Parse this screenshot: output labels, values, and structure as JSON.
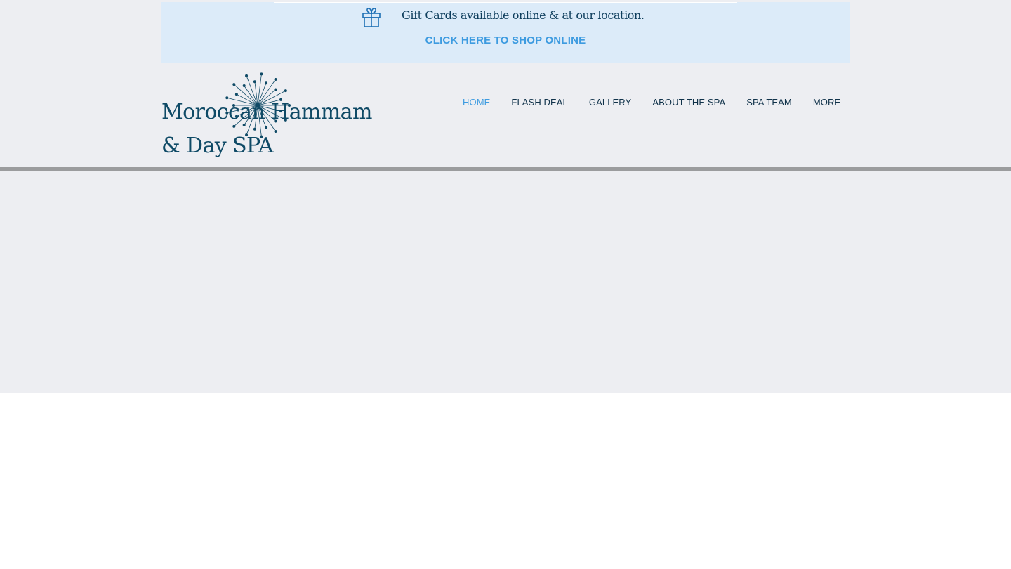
{
  "banner": {
    "gift_icon": "gift-icon",
    "gift_text": "Gift Cards available online & at our location.",
    "shop_link": "CLICK HERE TO SHOP ONLINE"
  },
  "logo": {
    "line1": "Moroccan Hammam",
    "line2": "& Day SPA",
    "burst_icon": "starburst-icon"
  },
  "nav": {
    "items": [
      {
        "label": "HOME",
        "active": true
      },
      {
        "label": "FLASH DEAL"
      },
      {
        "label": "GALLERY"
      },
      {
        "label": "ABOUT THE SPA"
      },
      {
        "label": "SPA TEAM"
      },
      {
        "label": "MORE"
      }
    ]
  },
  "colors": {
    "page_background": "#edeef2",
    "banner_background": "#dcebf9",
    "accent": "#3d9be0",
    "brand_dark": "#0f4a66",
    "divider": "#9b9c9e"
  }
}
